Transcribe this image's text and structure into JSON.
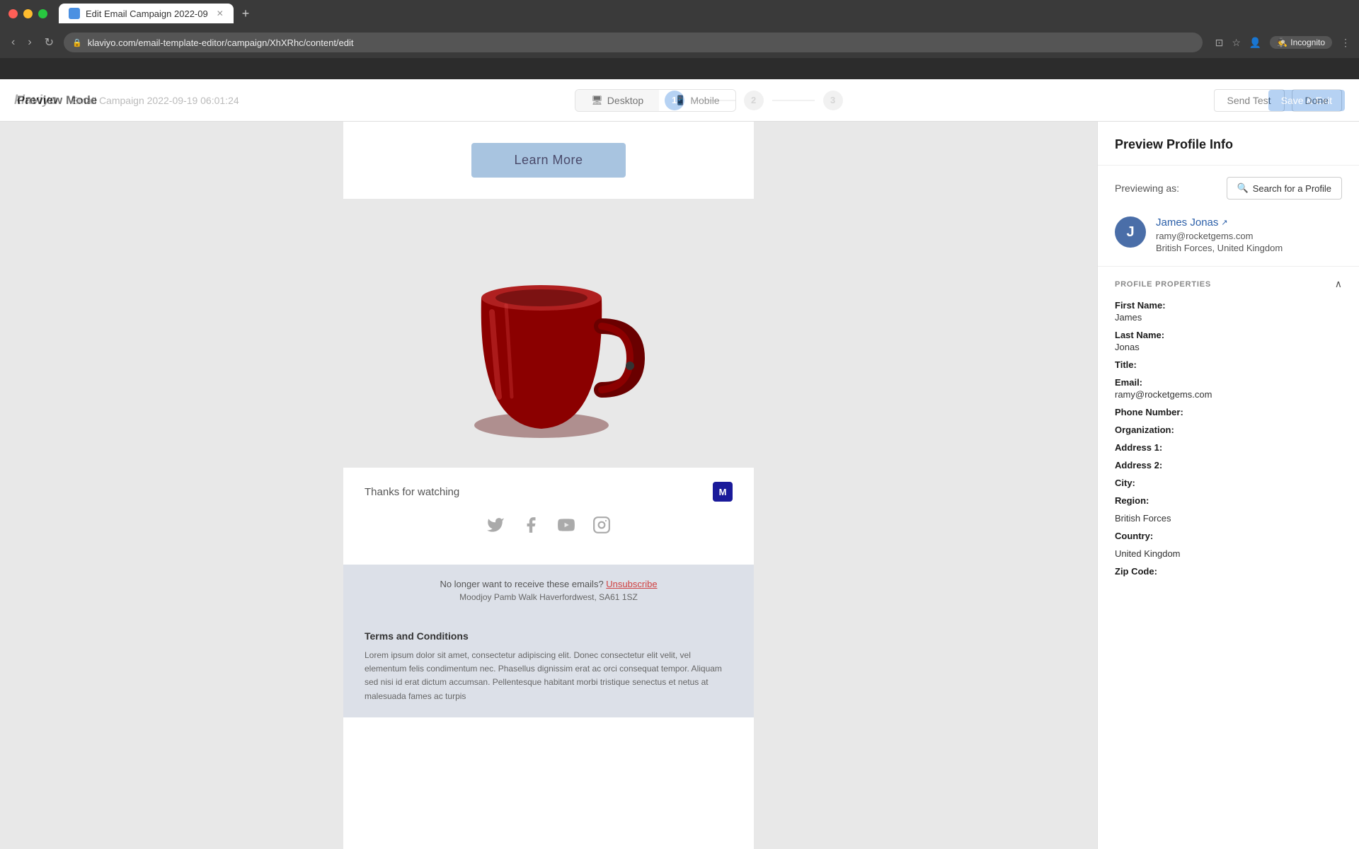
{
  "browser": {
    "url": "klaviyo.com/email-template-editor/campaign/XhXRhc/content/edit",
    "tab_title": "Edit Email Campaign 2022-09",
    "incognito_label": "Incognito"
  },
  "app": {
    "logo": "klaviyo",
    "campaign_title": "Email Campaign 2022-09-19 06:01:24",
    "steps": [
      "1",
      "2",
      "3"
    ],
    "save_exit_label": "Save & Exit"
  },
  "preview": {
    "title": "Preview Mode",
    "tabs": [
      {
        "label": "Desktop",
        "icon": "🖥",
        "active": true
      },
      {
        "label": "Mobile",
        "icon": "📱",
        "active": false
      }
    ],
    "send_test_label": "Send Test",
    "done_label": "Done"
  },
  "email_content": {
    "learn_more_label": "Learn More",
    "footer_text": "Thanks for watching",
    "footer_logo": "M",
    "social_icons": [
      "twitter",
      "facebook",
      "youtube",
      "instagram"
    ],
    "unsubscribe_text": "No longer want to receive these emails?",
    "unsubscribe_link": "Unsubscribe",
    "address": "Moodjoy Pamb Walk Haverfordwest, SA61 1SZ",
    "terms_title": "Terms and Conditions",
    "terms_text": "Lorem ipsum dolor sit amet, consectetur adipiscing elit. Donec consectetur elit velit, vel elementum felis condimentum nec. Phasellus dignissim erat ac orci consequat tempor. Aliquam sed nisi id erat dictum accumsan. Pellentesque habitant morbi tristique senectus et netus at malesuada fames ac turpis"
  },
  "right_panel": {
    "title": "Preview Profile Info",
    "previewing_label": "Previewing as:",
    "search_profile_label": "Search for a Profile",
    "profile": {
      "avatar_letter": "J",
      "name": "James Jonas",
      "email": "ramy@rocketgems.com",
      "location": "British Forces, United Kingdom"
    },
    "properties_title": "PROFILE PROPERTIES",
    "properties": [
      {
        "label": "First Name:",
        "value": "James"
      },
      {
        "label": "Last Name:",
        "value": "Jonas"
      },
      {
        "label": "Title:",
        "value": ""
      },
      {
        "label": "Email:",
        "value": "ramy@rocketgems.com"
      },
      {
        "label": "Phone Number:",
        "value": ""
      },
      {
        "label": "Organization:",
        "value": ""
      },
      {
        "label": "Address 1:",
        "value": ""
      },
      {
        "label": "Address 2:",
        "value": ""
      },
      {
        "label": "City:",
        "value": ""
      },
      {
        "label": "Region:",
        "value": ""
      },
      {
        "label": "British Forces",
        "value": ""
      },
      {
        "label": "Country:",
        "value": ""
      },
      {
        "label": "United Kingdom",
        "value": ""
      },
      {
        "label": "Zip Code:",
        "value": ""
      }
    ]
  }
}
